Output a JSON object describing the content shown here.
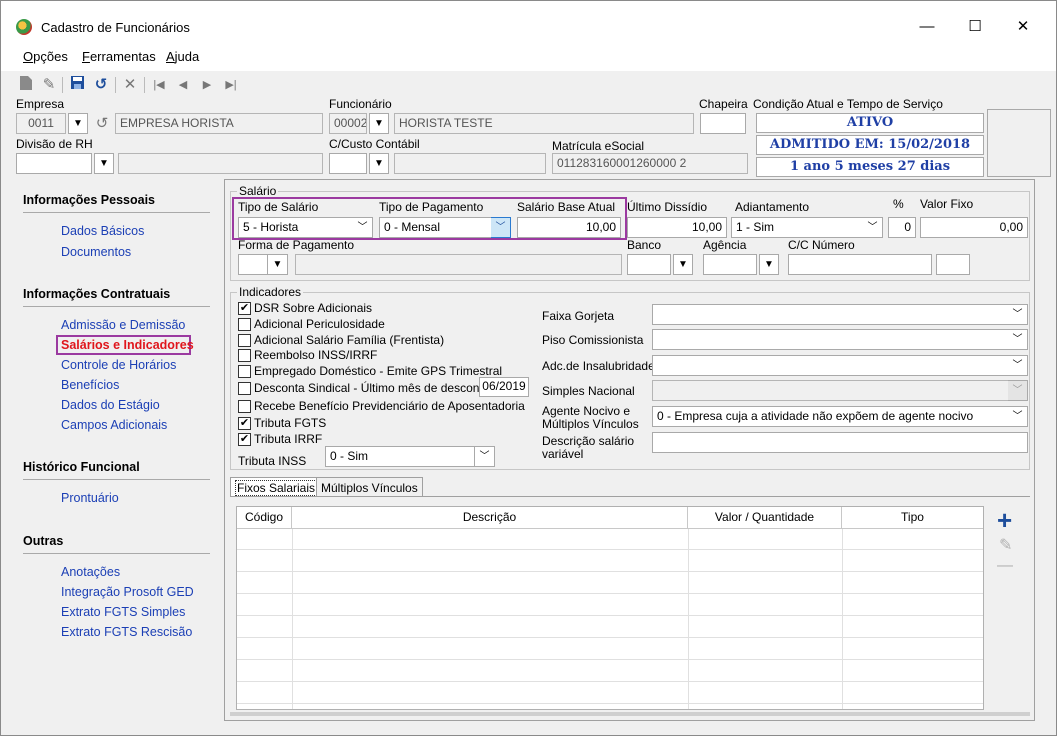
{
  "window": {
    "title": "Cadastro de Funcionários",
    "minimize": "—",
    "maximize": "☐",
    "close": "✕"
  },
  "menu": [
    {
      "first": "O",
      "rest": "pções"
    },
    {
      "first": "F",
      "rest": "erramentas"
    },
    {
      "first": "A",
      "rest": "juda"
    }
  ],
  "toolbar": {
    "new_icon": "new-document-icon",
    "edit_icon": "pencil-icon",
    "save_icon": "floppy-icon",
    "undo_icon": "undo-icon",
    "delete_icon": "delete-x-icon",
    "first_icon": "first-record-icon",
    "prev_icon": "prev-record-icon",
    "next_icon": "next-record-icon",
    "last_icon": "last-record-icon"
  },
  "header": {
    "empresa_label": "Empresa",
    "empresa_code": "0011",
    "empresa_name": "EMPRESA HORISTA",
    "funcionario_label": "Funcionário",
    "funcionario_code": "00002",
    "funcionario_name": "HORISTA TESTE",
    "chapeira_label": "Chapeira",
    "chapeira_value": "",
    "condicao_label": "Condição Atual e Tempo de Serviço",
    "status": "ATIVO",
    "admitido": "ADMITIDO EM: 15/02/2018",
    "tempo": "1 ano 5 meses 27 dias",
    "divisao_label": "Divisão de RH",
    "divisao_value": "",
    "ccusto_label": "C/Custo Contábil",
    "ccusto_value": "",
    "matricula_label": "Matrícula eSocial",
    "matricula_value": "011283160001260000 2"
  },
  "sidebar": {
    "sections": [
      {
        "title": "Informações Pessoais",
        "items": [
          "Dados Básicos",
          "Documentos"
        ]
      },
      {
        "title": "Informações Contratuais",
        "items": [
          "Admissão e Demissão",
          "Salários e Indicadores",
          "Controle de Horários",
          "Benefícios",
          "Dados do Estágio",
          "Campos Adicionais"
        ]
      },
      {
        "title": "Histórico Funcional",
        "items": [
          "Prontuário"
        ]
      },
      {
        "title": "Outras",
        "items": [
          "Anotações",
          "Integração Prosoft GED",
          "Extrato FGTS Simples",
          "Extrato FGTS Rescisão"
        ]
      }
    ]
  },
  "salario": {
    "group_title": "Salário",
    "tipo_salario_label": "Tipo de Salário",
    "tipo_salario_value": "5 - Horista",
    "tipo_pagamento_label": "Tipo de Pagamento",
    "tipo_pagamento_value": "0 - Mensal",
    "salario_base_label": "Salário Base Atual",
    "salario_base_value": "10,00",
    "ultimo_dissidio_label": "Último Dissídio",
    "ultimo_dissidio_value": "10,00",
    "adiantamento_label": "Adiantamento",
    "adiantamento_value": "1 - Sim",
    "percent_label": "%",
    "percent_value": "0",
    "valor_fixo_label": "Valor Fixo",
    "valor_fixo_value": "0,00",
    "forma_pagamento_label": "Forma de Pagamento",
    "banco_label": "Banco",
    "agencia_label": "Agência",
    "cc_label": "C/C Número"
  },
  "indicadores": {
    "group_title": "Indicadores",
    "checks": [
      {
        "label": "DSR Sobre Adicionais",
        "checked": "✔"
      },
      {
        "label": "Adicional Periculosidade",
        "checked": ""
      },
      {
        "label": "Adicional Salário Família (Frentista)",
        "checked": ""
      },
      {
        "label": "Reembolso INSS/IRRF",
        "checked": ""
      },
      {
        "label": "Empregado Doméstico - Emite GPS Trimestral",
        "checked": ""
      },
      {
        "label": "Desconta Sindical - Último mês de desconto",
        "checked": ""
      },
      {
        "label": "Recebe Benefício Previdenciário de Aposentadoria",
        "checked": ""
      },
      {
        "label": "Tributa FGTS",
        "checked": "✔"
      },
      {
        "label": "Tributa IRRF",
        "checked": "✔"
      }
    ],
    "desconta_mes": "06/2019",
    "tributa_inss_label": "Tributa INSS",
    "tributa_inss_value": "0 - Sim",
    "faixa_gorjeta_label": "Faixa Gorjeta",
    "piso_label": "Piso Comissionista",
    "adc_insalubridade_label": "Adc.de Insalubridade",
    "simples_label": "Simples Nacional",
    "agente_label_1": "Agente Nocivo e",
    "agente_label_2": "Múltiplos Vínculos",
    "agente_value": "0 - Empresa cuja a atividade não expõem de agente nocivo",
    "descricao_label_1": "Descrição salário",
    "descricao_label_2": "variável"
  },
  "tabs": [
    "Fixos Salariais",
    "Múltiplos Vínculos"
  ],
  "grid": {
    "columns": [
      "Código",
      "Descrição",
      "Valor / Quantidade",
      "Tipo"
    ]
  },
  "grid_actions": {
    "add": "+",
    "edit": "✎",
    "remove": "—"
  }
}
